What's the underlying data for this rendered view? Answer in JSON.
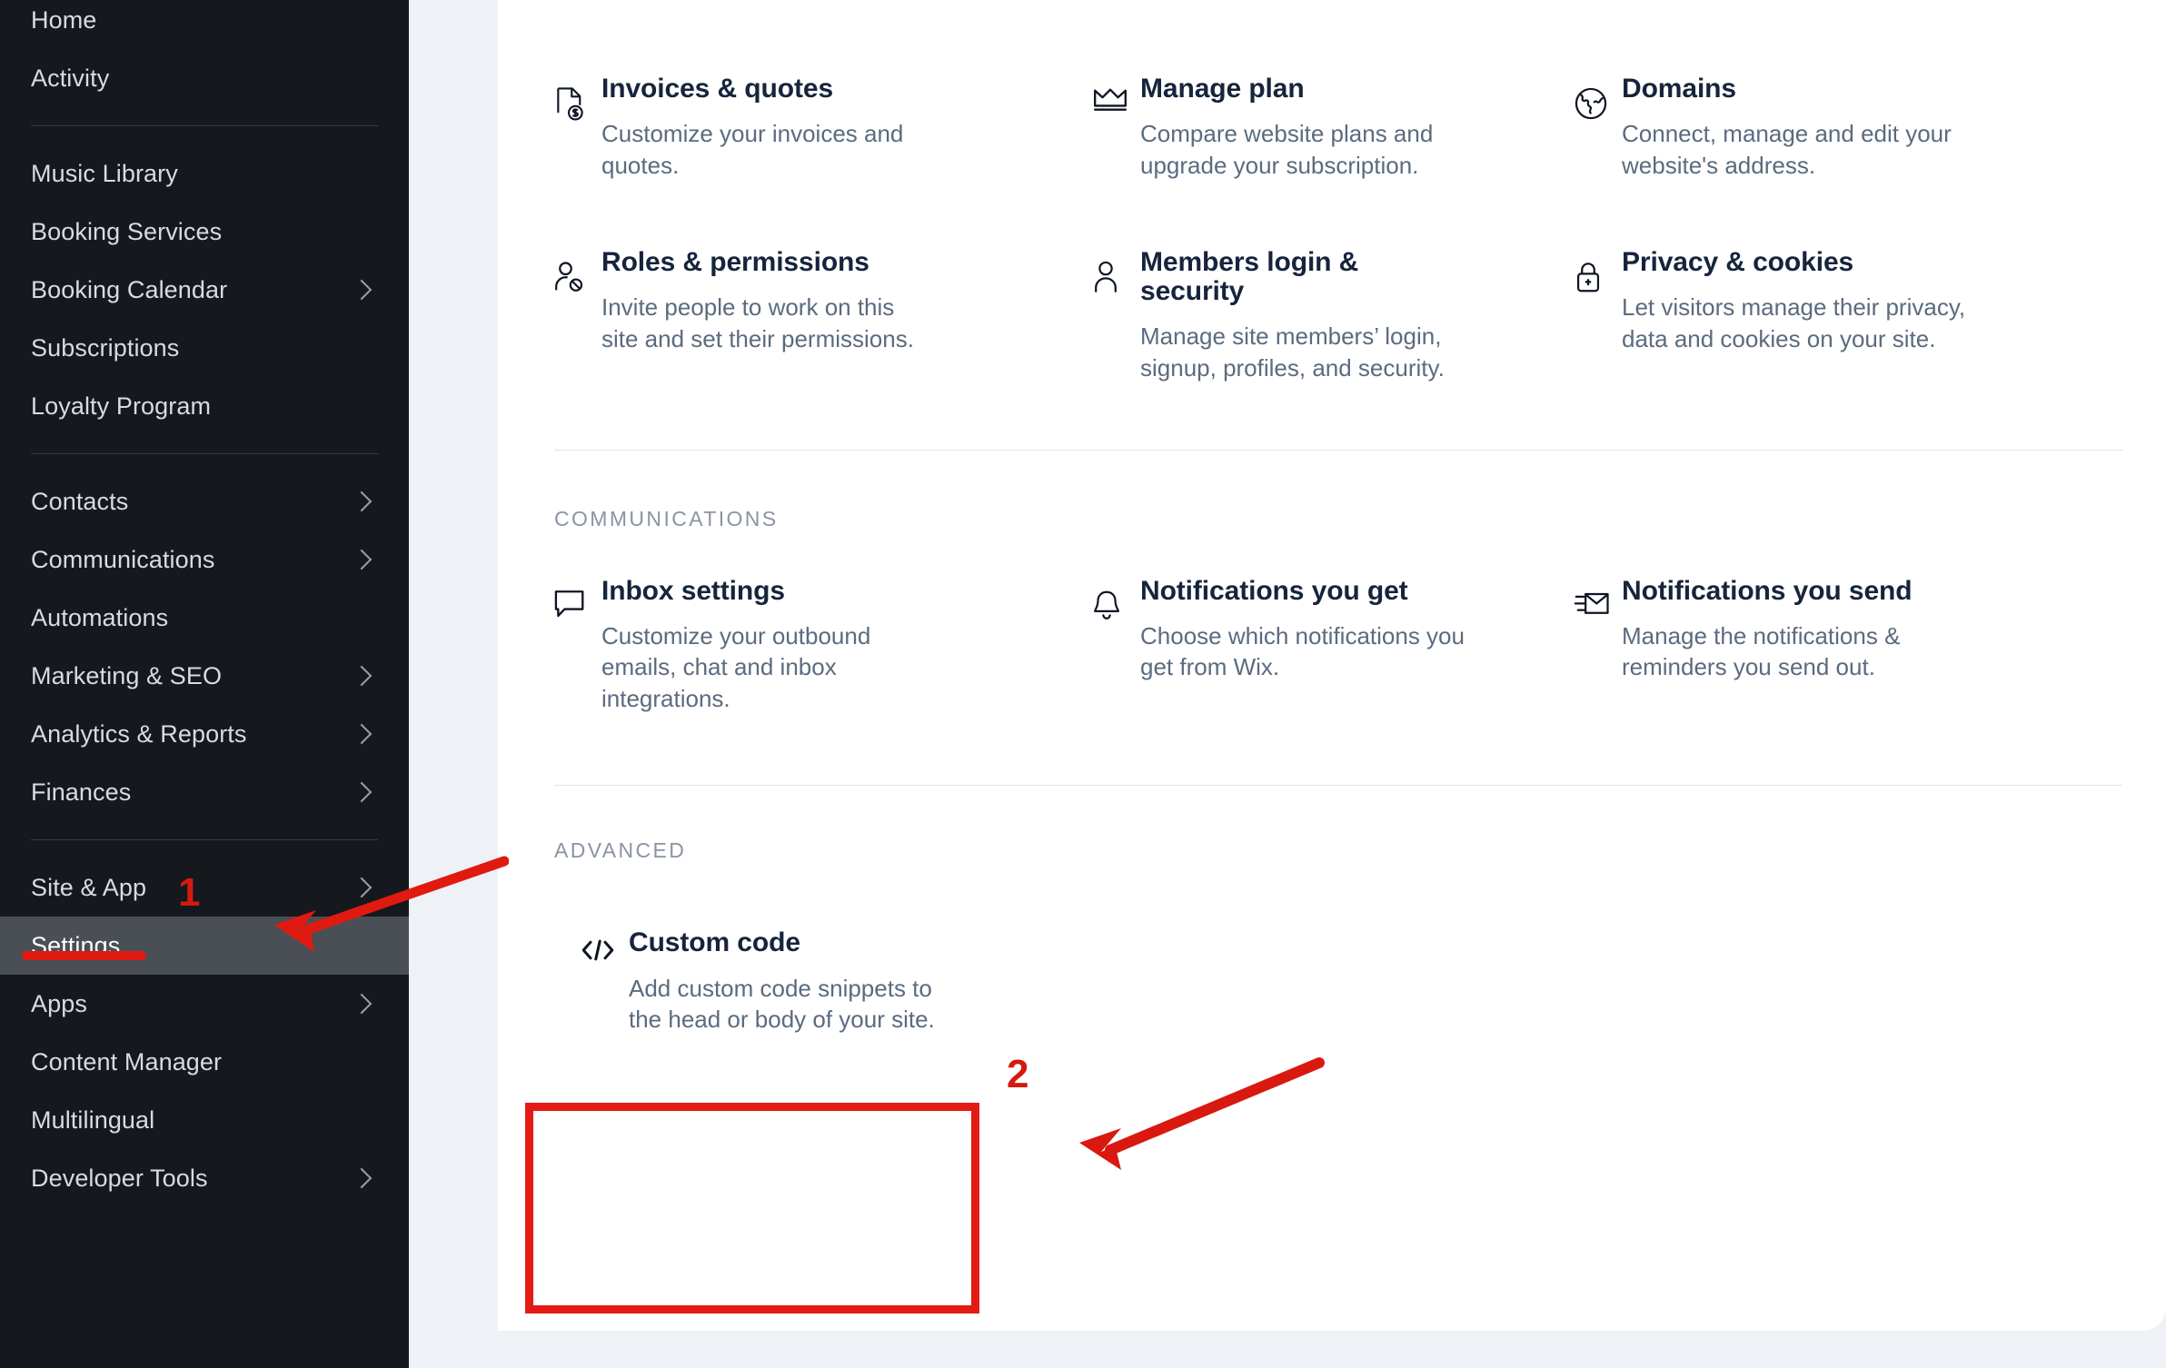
{
  "sidebar": {
    "groups": [
      {
        "items": [
          {
            "label": "Home",
            "chevron": false,
            "active": false
          },
          {
            "label": "Activity",
            "chevron": false,
            "active": false
          }
        ]
      },
      {
        "items": [
          {
            "label": "Music Library",
            "chevron": false,
            "active": false
          },
          {
            "label": "Booking Services",
            "chevron": false,
            "active": false
          },
          {
            "label": "Booking Calendar",
            "chevron": true,
            "active": false
          },
          {
            "label": "Subscriptions",
            "chevron": false,
            "active": false
          },
          {
            "label": "Loyalty Program",
            "chevron": false,
            "active": false
          }
        ]
      },
      {
        "items": [
          {
            "label": "Contacts",
            "chevron": true,
            "active": false
          },
          {
            "label": "Communications",
            "chevron": true,
            "active": false
          },
          {
            "label": "Automations",
            "chevron": false,
            "active": false
          },
          {
            "label": "Marketing & SEO",
            "chevron": true,
            "active": false
          },
          {
            "label": "Analytics & Reports",
            "chevron": true,
            "active": false
          },
          {
            "label": "Finances",
            "chevron": true,
            "active": false
          }
        ]
      },
      {
        "items": [
          {
            "label": "Site & App",
            "chevron": true,
            "active": false
          },
          {
            "label": "Settings",
            "chevron": false,
            "active": true
          },
          {
            "label": "Apps",
            "chevron": true,
            "active": false
          },
          {
            "label": "Content Manager",
            "chevron": false,
            "active": false
          },
          {
            "label": "Multilingual",
            "chevron": false,
            "active": false
          },
          {
            "label": "Developer Tools",
            "chevron": true,
            "active": false
          }
        ]
      }
    ]
  },
  "main": {
    "rows": [
      {
        "cards": [
          {
            "icon": "invoice-dollar-icon",
            "title": "Invoices & quotes",
            "desc": "Customize your invoices and quotes."
          },
          {
            "icon": "crown-icon",
            "title": "Manage plan",
            "desc": "Compare website plans and upgrade your subscription."
          },
          {
            "icon": "globe-icon",
            "title": "Domains",
            "desc": "Connect, manage and edit your website's address."
          }
        ]
      },
      {
        "cards": [
          {
            "icon": "user-blocked-icon",
            "title": "Roles & permissions",
            "desc": "Invite people to work on this site and set their permissions."
          },
          {
            "icon": "user-icon",
            "title": "Members login & security",
            "desc": "Manage site members’ login, signup, profiles, and security."
          },
          {
            "icon": "lock-icon",
            "title": "Privacy & cookies",
            "desc": "Let visitors manage their privacy, data and cookies on your site."
          }
        ]
      },
      {
        "cards": [
          {
            "icon": "chat-bubble-icon",
            "title": "Inbox settings",
            "desc": "Customize your outbound emails, chat and inbox integrations."
          },
          {
            "icon": "bell-icon",
            "title": "Notifications you get",
            "desc": "Choose which notifications you get from Wix."
          },
          {
            "icon": "envelope-send-icon",
            "title": "Notifications you send",
            "desc": "Manage the notifications & reminders you send out."
          }
        ]
      },
      {
        "cards": [
          {
            "icon": "code-tag-icon",
            "title": "Custom code",
            "desc": "Add custom code snippets to the head or body of your site."
          }
        ]
      }
    ],
    "section_labels": {
      "communications": "COMMUNICATIONS",
      "advanced": "ADVANCED"
    }
  },
  "annotations": {
    "marker_one": "1",
    "marker_two": "2",
    "accent_color": "#e01a10"
  }
}
